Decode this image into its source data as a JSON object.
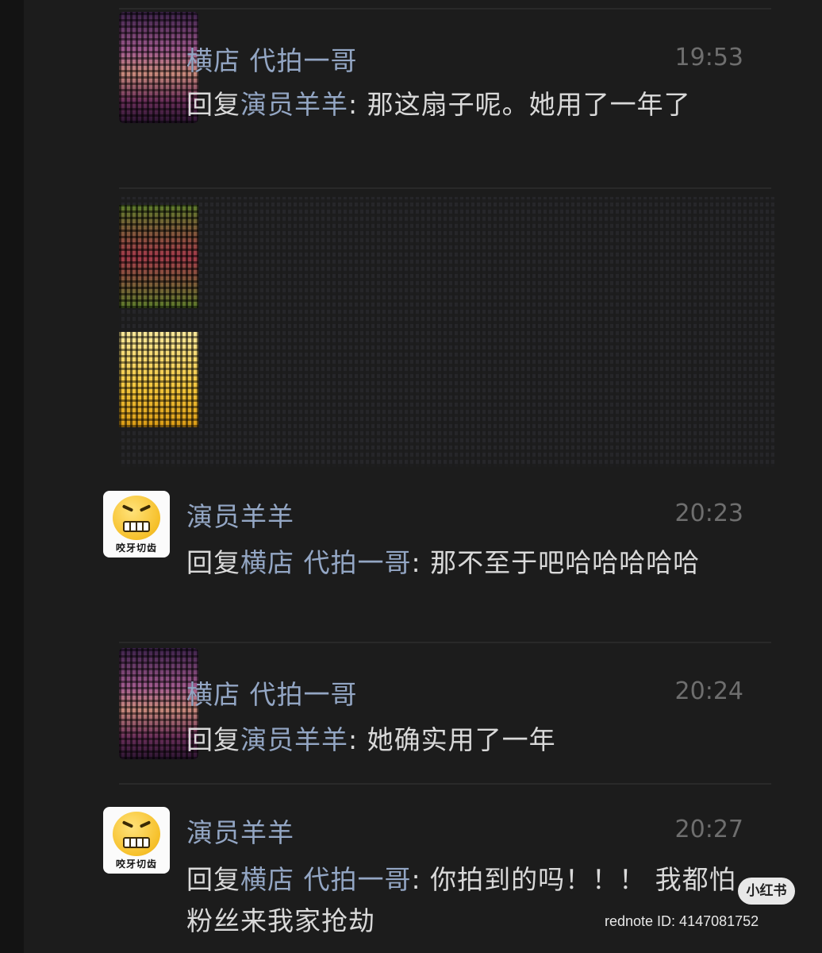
{
  "comments": [
    {
      "name": "横店 代拍一哥",
      "time": "19:53",
      "reply_prefix": "回复",
      "reply_to": "演员羊羊",
      "text": ": 那这扇子呢。她用了一年了",
      "avatar": "pixelated-avatar"
    },
    {
      "name": "演员羊羊",
      "time": "20:23",
      "reply_prefix": "回复",
      "reply_to": "横店 代拍一哥",
      "text": ": 那不至于吧哈哈哈哈哈",
      "avatar": "teeth-grinding-emoji",
      "avatar_caption": "咬牙切齿"
    },
    {
      "name": "横店 代拍一哥",
      "time": "20:24",
      "reply_prefix": "回复",
      "reply_to": "演员羊羊",
      "text": ": 她确实用了一年",
      "avatar": "pixelated-avatar"
    },
    {
      "name": "演员羊羊",
      "time": "20:27",
      "reply_prefix": "回复",
      "reply_to": "横店 代拍一哥",
      "text": ": 你拍到的吗！！！ 我都怕粉丝来我家抢劫",
      "avatar": "teeth-grinding-emoji",
      "avatar_caption": "咬牙切齿"
    }
  ],
  "watermark": {
    "badge": "小红书",
    "id_text": "rednote ID: 4147081752"
  },
  "colors": {
    "background": "#1c1c1c",
    "name": "#93a6c4",
    "body_text": "#d9d9d9",
    "time": "#6e6e6e"
  }
}
